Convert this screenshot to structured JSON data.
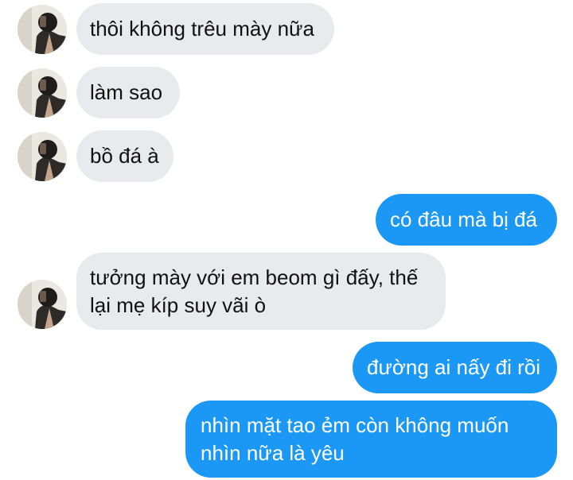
{
  "conversation": {
    "messages": [
      {
        "direction": "incoming",
        "text": "thôi không trêu mày nữa"
      },
      {
        "direction": "incoming",
        "text": "làm sao"
      },
      {
        "direction": "incoming",
        "text": "bồ đá à"
      },
      {
        "direction": "outgoing",
        "text": "có đâu mà bị đá"
      },
      {
        "direction": "incoming",
        "lines": [
          "tưởng mày với em beom gì đấy, thế",
          "lại mẹ kíp suy vãi ò"
        ]
      },
      {
        "direction": "outgoing",
        "text": "đường ai nấy đi rồi"
      },
      {
        "direction": "outgoing",
        "lines": [
          "nhìn mặt tao ẻm còn không muốn",
          "nhìn nữa là yêu"
        ]
      }
    ]
  },
  "colors": {
    "incoming_bubble": "#e8ebee",
    "outgoing_bubble": "#1b98f5",
    "incoming_text": "#111111",
    "outgoing_text": "#ffffff"
  },
  "icons": {
    "contact_avatar": "avatar-photo-icon"
  }
}
